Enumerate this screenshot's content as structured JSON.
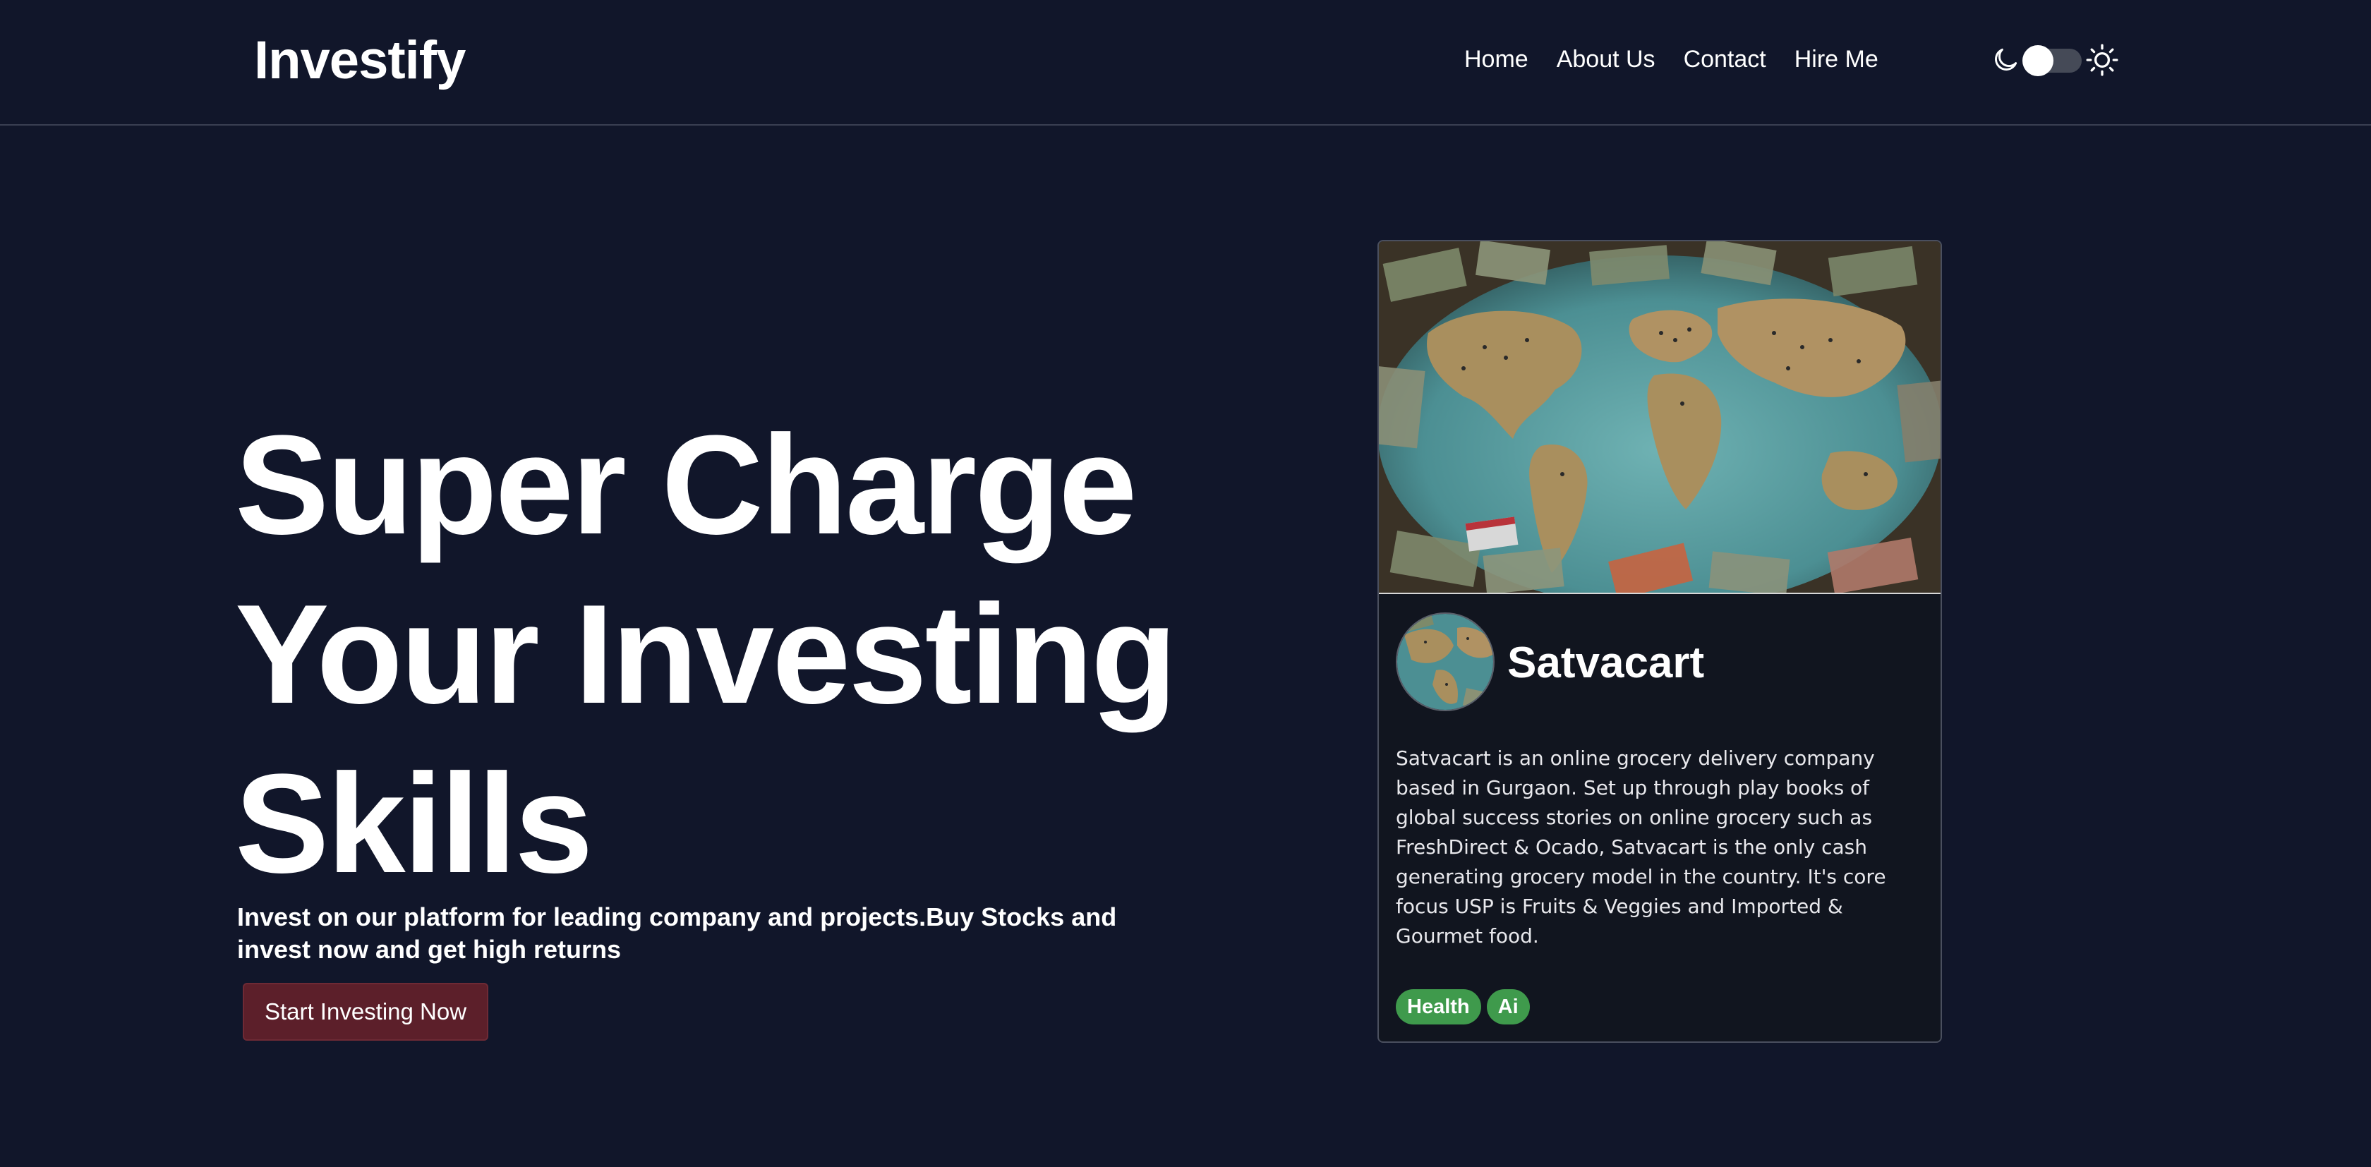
{
  "header": {
    "logo": "Investify",
    "nav": [
      "Home",
      "About Us",
      "Contact",
      "Hire Me"
    ]
  },
  "hero": {
    "title_lines": [
      "Super Charge",
      "Your Investing",
      "Skills"
    ],
    "subtitle": "Invest on our platform for leading company and projects.Buy Stocks and invest now and get high returns",
    "cta_label": "Start Investing Now"
  },
  "card": {
    "image_alt": "world map with scattered banknotes",
    "title": "Satvacart",
    "description": "Satvacart is an online grocery delivery company based in Gurgaon. Set up through play books of global success stories on online grocery such as FreshDirect & Ocado, Satvacart is the only cash generating grocery model in the country. It's core focus USP is Fruits & Veggies and Imported & Gourmet food.",
    "tags": [
      "Health",
      "Ai"
    ]
  },
  "icons": {
    "moon": "moon-icon",
    "sun": "sun-icon"
  },
  "colors": {
    "background": "#11162a",
    "cta_background": "#5c1f2a",
    "tag_background": "#3f9a4c"
  }
}
